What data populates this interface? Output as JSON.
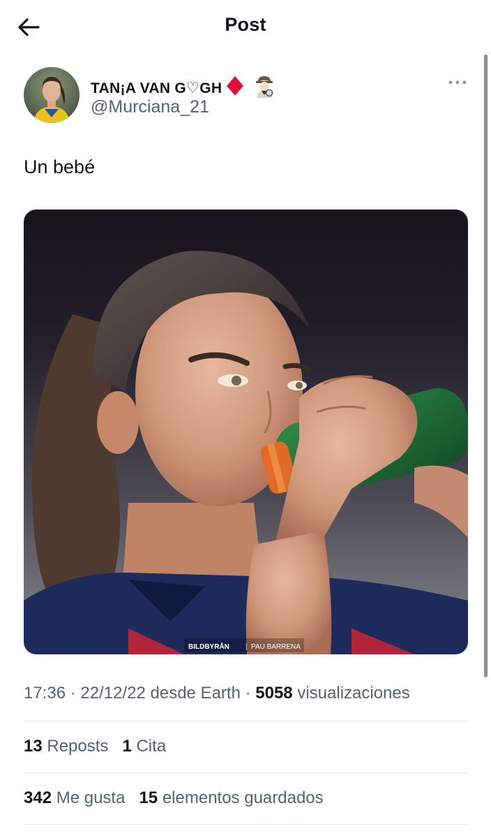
{
  "header": {
    "title": "Post",
    "back_icon": "arrow-left-icon"
  },
  "author": {
    "name": "TAN¡A VAN G♡GH",
    "name_emojis": [
      "diamond-suit-icon",
      "detective-icon"
    ],
    "handle": "@Murciana_21",
    "more_icon": "ellipsis-icon"
  },
  "tweet": {
    "text": "Un bebé"
  },
  "media": {
    "watermark_brand": "BILDBYRÅN",
    "watermark_credit": "PAU BARRENA"
  },
  "meta": {
    "time": "17:36",
    "date": "22/12/22",
    "source": "desde Earth",
    "views_count": "5058",
    "views_label": "visualizaciones"
  },
  "stats": {
    "reposts_count": "13",
    "reposts_label": "Reposts",
    "quotes_count": "1",
    "quotes_label": "Cita",
    "likes_count": "342",
    "likes_label": "Me gusta",
    "bookmarks_count": "15",
    "bookmarks_label": "elementos guardados"
  },
  "colors": {
    "text_primary": "#0f1419",
    "text_secondary": "#536471",
    "divider": "#e1e4e8",
    "diamond": "#e0103a"
  }
}
